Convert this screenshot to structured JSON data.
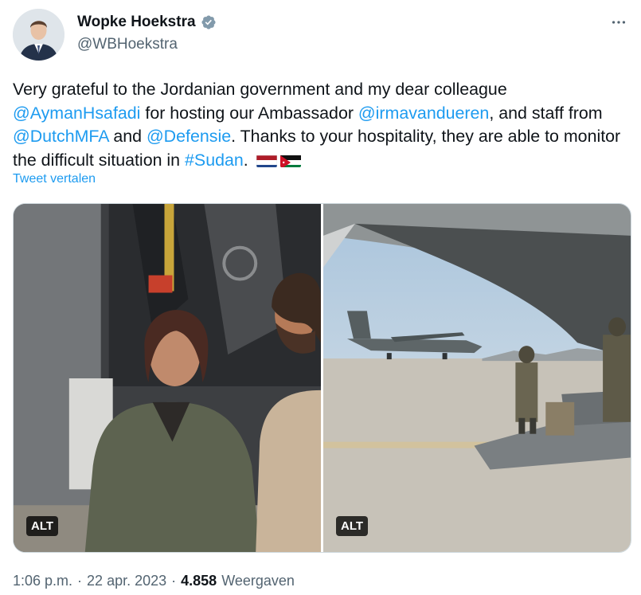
{
  "author": {
    "display_name": "Wopke Hoekstra",
    "handle": "@WBHoekstra",
    "verified_icon": "verified-badge-icon",
    "avatar_icon": "profile-photo"
  },
  "more_icon": "more-options-icon",
  "tweet": {
    "part1": "Very grateful to the Jordanian government and my dear colleague ",
    "mention1": "@AymanHsafadi",
    "part2": " for hosting our Ambassador ",
    "mention2": "@irmavandueren",
    "part3": ", and staff from ",
    "mention3": "@DutchMFA",
    "part4": " and ",
    "mention4": "@Defensie",
    "part5": ". Thanks to your hospitality, they are able to monitor the difficult situation in ",
    "hashtag": "#Sudan",
    "part6": ". ",
    "flags": [
      "netherlands-flag",
      "jordan-flag"
    ]
  },
  "translate_label": "Tweet vertalen",
  "media": {
    "left_alt_label": "ALT",
    "right_alt_label": "ALT"
  },
  "meta": {
    "time": "1:06 p.m.",
    "sep1": "·",
    "date": "22 apr. 2023",
    "sep2": "·",
    "views_count": "4.858",
    "views_label": "Weergaven"
  },
  "colors": {
    "link": "#1d9bf0",
    "text": "#0f1419",
    "secondary": "#536471"
  }
}
